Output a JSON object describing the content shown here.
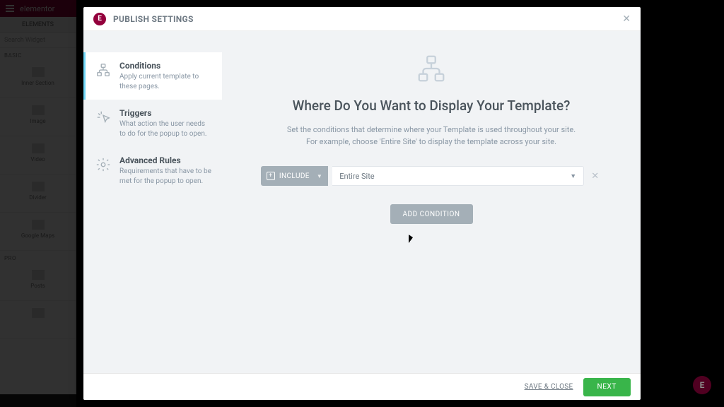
{
  "bg": {
    "app_name": "elementor",
    "widgets_tab": "ELEMENTS",
    "search_placeholder": "Search Widget",
    "basic_label": "BASIC",
    "pro_label": "PRO",
    "widgets": [
      {
        "label": "Inner Section"
      },
      {
        "label": "Image"
      },
      {
        "label": "Video"
      },
      {
        "label": "Divider"
      },
      {
        "label": "Google Maps"
      }
    ],
    "pro_widgets": [
      {
        "label": "Posts"
      }
    ],
    "fab_glyph": "E"
  },
  "modal": {
    "logo_glyph": "E",
    "title": "PUBLISH SETTINGS",
    "sidebar": [
      {
        "title": "Conditions",
        "desc": "Apply current template to these pages."
      },
      {
        "title": "Triggers",
        "desc": "What action the user needs to do for the popup to open."
      },
      {
        "title": "Advanced Rules",
        "desc": "Requirements that have to be met for the popup to open."
      }
    ],
    "main": {
      "title": "Where Do You Want to Display Your Template?",
      "desc_line1": "Set the conditions that determine where your Template is used throughout your site.",
      "desc_line2": "For example, choose 'Entire Site' to display the template across your site.",
      "include_label": "INCLUDE",
      "selected_scope": "Entire Site",
      "add_condition": "ADD CONDITION"
    },
    "footer": {
      "save_close": "SAVE & CLOSE",
      "next": "NEXT"
    }
  }
}
